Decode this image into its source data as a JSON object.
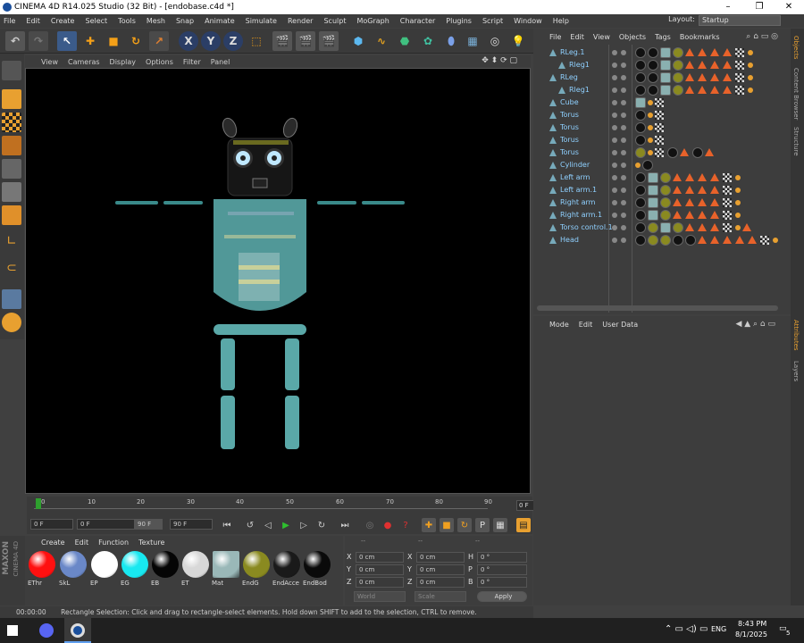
{
  "window": {
    "title": "CINEMA 4D R14.025 Studio (32 Bit) - [endobase.c4d *]",
    "min": "–",
    "max": "❐",
    "close": "✕"
  },
  "menubar": {
    "items": [
      "File",
      "Edit",
      "Create",
      "Select",
      "Tools",
      "Mesh",
      "Snap",
      "Animate",
      "Simulate",
      "Render",
      "Sculpt",
      "MoGraph",
      "Character",
      "Plugins",
      "Script",
      "Window",
      "Help"
    ],
    "layout_label": "Layout:",
    "layout_value": "Startup"
  },
  "viewport": {
    "menu": [
      "View",
      "Cameras",
      "Display",
      "Options",
      "Filter",
      "Panel"
    ]
  },
  "timeline": {
    "ticks": [
      "0",
      "10",
      "20",
      "30",
      "40",
      "50",
      "60",
      "70",
      "80",
      "90"
    ],
    "current_frame": "0 F"
  },
  "transport": {
    "start": "0 F",
    "min": "0 F",
    "max": "90 F",
    "end": "90 F"
  },
  "materials": {
    "menu": [
      "Create",
      "Edit",
      "Function",
      "Texture"
    ],
    "items": [
      {
        "label": "EThr",
        "color": "#ff1010"
      },
      {
        "label": "SkL",
        "color": "#6a88c8"
      },
      {
        "label": "EP",
        "color": "#ffffff"
      },
      {
        "label": "EG",
        "color": "#18e8f0"
      },
      {
        "label": "EB",
        "color": "#050505"
      },
      {
        "label": "ET",
        "color": "#d8d8d8"
      },
      {
        "label": "Mat",
        "color": "#9ab8b8"
      },
      {
        "label": "EndG",
        "color": "#8a8a20"
      },
      {
        "label": "EndAcce",
        "color": "#1a1a1a"
      },
      {
        "label": "EndBod",
        "color": "#0a0a0a"
      }
    ]
  },
  "coords": {
    "headers": [
      "--",
      "--",
      "--"
    ],
    "rows": [
      {
        "a": "X",
        "av": "0 cm",
        "b": "X",
        "bv": "0 cm",
        "c": "H",
        "cv": "0 °"
      },
      {
        "a": "Y",
        "av": "0 cm",
        "b": "Y",
        "bv": "0 cm",
        "c": "P",
        "cv": "0 °"
      },
      {
        "a": "Z",
        "av": "0 cm",
        "b": "Z",
        "bv": "0 cm",
        "c": "B",
        "cv": "0 °"
      }
    ],
    "world": "World",
    "scale": "Scale",
    "apply": "Apply"
  },
  "status": {
    "time": "00:00:00",
    "message": "Rectangle Selection: Click and drag to rectangle-select elements. Hold down SHIFT to add to the selection, CTRL to remove."
  },
  "objects": {
    "menu": [
      "File",
      "Edit",
      "View",
      "Objects",
      "Tags",
      "Bookmarks"
    ],
    "rows": [
      {
        "name": "RLeg.1",
        "indent": 0
      },
      {
        "name": "Rleg1",
        "indent": 1
      },
      {
        "name": "RLeg",
        "indent": 0
      },
      {
        "name": "Rleg1",
        "indent": 1
      },
      {
        "name": "Cube",
        "indent": 0
      },
      {
        "name": "Torus",
        "indent": 0
      },
      {
        "name": "Torus",
        "indent": 0
      },
      {
        "name": "Torus",
        "indent": 0
      },
      {
        "name": "Torus",
        "indent": 0
      },
      {
        "name": "Cylinder",
        "indent": 0
      },
      {
        "name": "Left arm",
        "indent": 0
      },
      {
        "name": "Left arm.1",
        "indent": 0
      },
      {
        "name": "Right arm",
        "indent": 0
      },
      {
        "name": "Right arm.1",
        "indent": 0
      },
      {
        "name": "Torso control.1",
        "indent": 0
      },
      {
        "name": "Head",
        "indent": 0
      }
    ]
  },
  "attributes": {
    "menu": [
      "Mode",
      "Edit",
      "User Data"
    ]
  },
  "sidetabs": [
    "Objects",
    "Content Browser",
    "Structure",
    "Attributes",
    "Layers"
  ],
  "taskbar": {
    "lang": "ENG",
    "time": "8:43 PM",
    "date": "8/1/2025",
    "notif": "5"
  },
  "brand": {
    "line1": "MAXON",
    "line2": "CINEMA 4D"
  },
  "toolbar_letters": {
    "x": "X",
    "y": "Y",
    "z": "Z"
  }
}
